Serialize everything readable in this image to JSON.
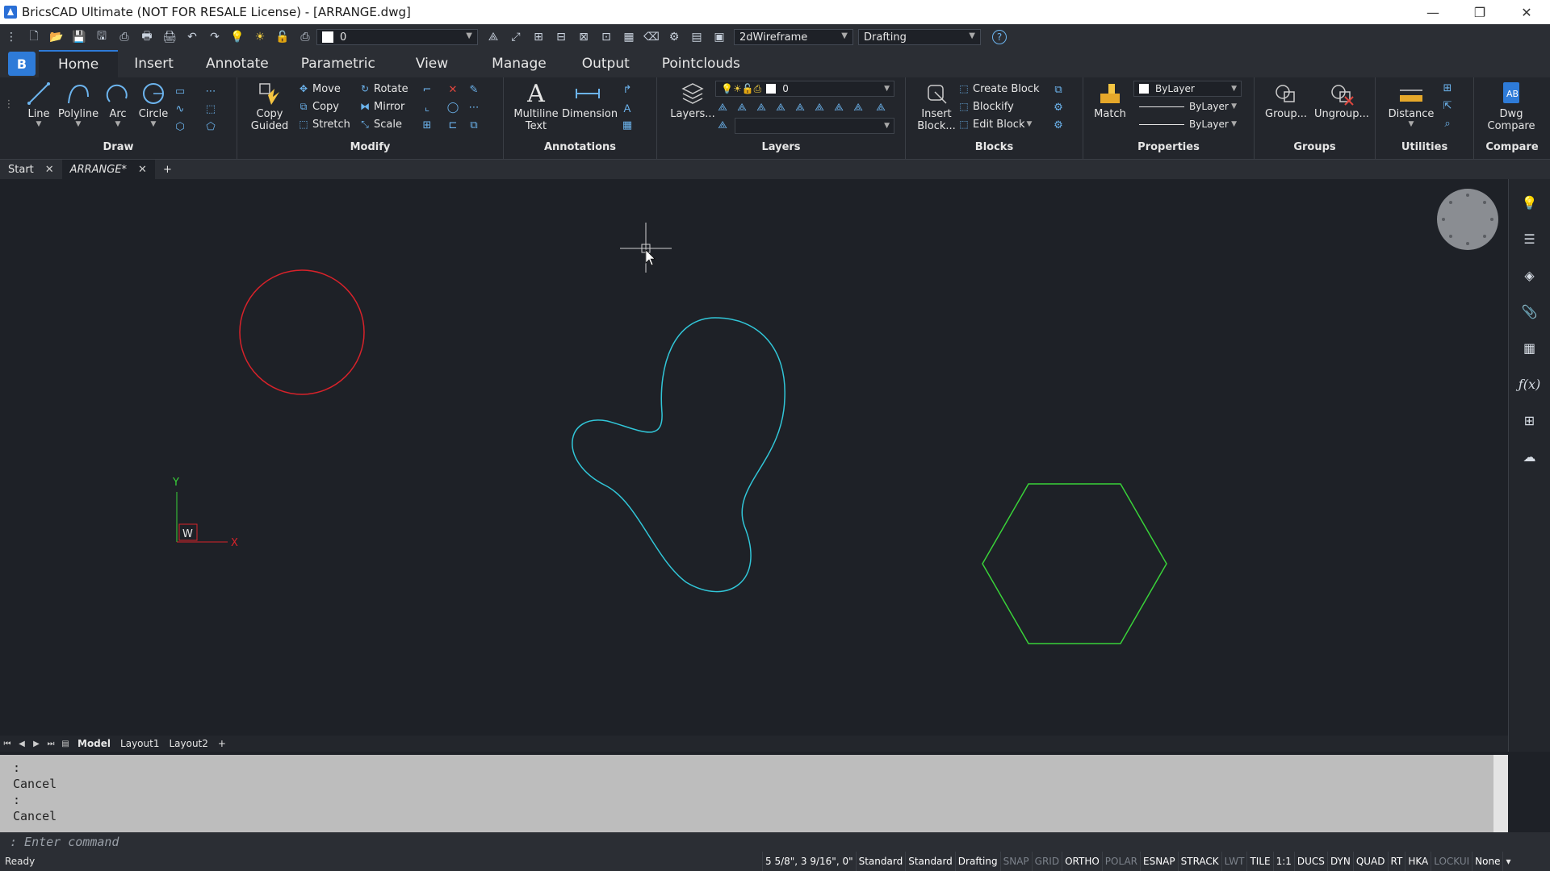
{
  "window": {
    "title": "BricsCAD Ultimate (NOT FOR RESALE License) - [ARRANGE.dwg]",
    "minimize": "—",
    "restore": "❐",
    "close": "✕"
  },
  "quick_access": {
    "layer_value": "0",
    "visual_style": "2dWireframe",
    "workspace": "Drafting",
    "help_icon": "?"
  },
  "app_button_label": "B",
  "ribbon_tabs": [
    "Home",
    "Insert",
    "Annotate",
    "Parametric",
    "View",
    "Manage",
    "Output",
    "Pointclouds"
  ],
  "ribbon": {
    "draw": {
      "label": "Draw",
      "line": "Line",
      "polyline": "Polyline",
      "arc": "Arc",
      "circle": "Circle"
    },
    "modify": {
      "label": "Modify",
      "copy_guided_1": "Copy",
      "copy_guided_2": "Guided",
      "move": "Move",
      "copy": "Copy",
      "stretch": "Stretch",
      "rotate": "Rotate",
      "mirror": "Mirror",
      "scale": "Scale"
    },
    "annotations": {
      "label": "Annotations",
      "mtext_1": "Multiline",
      "mtext_2": "Text",
      "dimension": "Dimension"
    },
    "layers": {
      "label": "Layers",
      "layers_button": "Layers...",
      "layer_value": "0"
    },
    "blocks": {
      "label": "Blocks",
      "insert_1": "Insert",
      "insert_2": "Block...",
      "create_block": "Create Block",
      "blockify": "Blockify",
      "edit_block": "Edit Block"
    },
    "properties": {
      "label": "Properties",
      "match": "Match",
      "color": "ByLayer",
      "linetype": "ByLayer",
      "lineweight": "ByLayer"
    },
    "groups": {
      "label": "Groups",
      "group": "Group...",
      "ungroup": "Ungroup..."
    },
    "utilities": {
      "label": "Utilities",
      "distance": "Distance"
    },
    "compare": {
      "label": "Compare",
      "dwg_compare_1": "Dwg",
      "dwg_compare_2": "Compare"
    }
  },
  "doc_tabs": [
    {
      "label": "Start",
      "close": "✕"
    },
    {
      "label": "ARRANGE*",
      "close": "✕"
    }
  ],
  "new_tab": "+",
  "drawing": {
    "circle_color": "#d8222a",
    "blob_color": "#31c6d8",
    "hexagon_color": "#39d239",
    "ucs_y": "Y",
    "ucs_x": "X",
    "ucs_w": "W"
  },
  "layout_tabs": [
    "Model",
    "Layout1",
    "Layout2"
  ],
  "layout_add": "+",
  "command_history": [
    ":",
    "Cancel",
    ":",
    "Cancel"
  ],
  "command_prompt": ": Enter command",
  "status": {
    "ready": "Ready",
    "coords": "5 5/8\", 3 9/16\", 0\"",
    "items": [
      {
        "label": "Standard",
        "on": true
      },
      {
        "label": "Standard",
        "on": true
      },
      {
        "label": "Drafting",
        "on": true
      },
      {
        "label": "SNAP",
        "on": false
      },
      {
        "label": "GRID",
        "on": false
      },
      {
        "label": "ORTHO",
        "on": true
      },
      {
        "label": "POLAR",
        "on": false
      },
      {
        "label": "ESNAP",
        "on": true
      },
      {
        "label": "STRACK",
        "on": true
      },
      {
        "label": "LWT",
        "on": false
      },
      {
        "label": "TILE",
        "on": true
      },
      {
        "label": "1:1",
        "on": true
      },
      {
        "label": "DUCS",
        "on": true
      },
      {
        "label": "DYN",
        "on": true
      },
      {
        "label": "QUAD",
        "on": true
      },
      {
        "label": "RT",
        "on": true
      },
      {
        "label": "HKA",
        "on": true
      },
      {
        "label": "LOCKUI",
        "on": false
      },
      {
        "label": "None",
        "on": true
      }
    ]
  }
}
